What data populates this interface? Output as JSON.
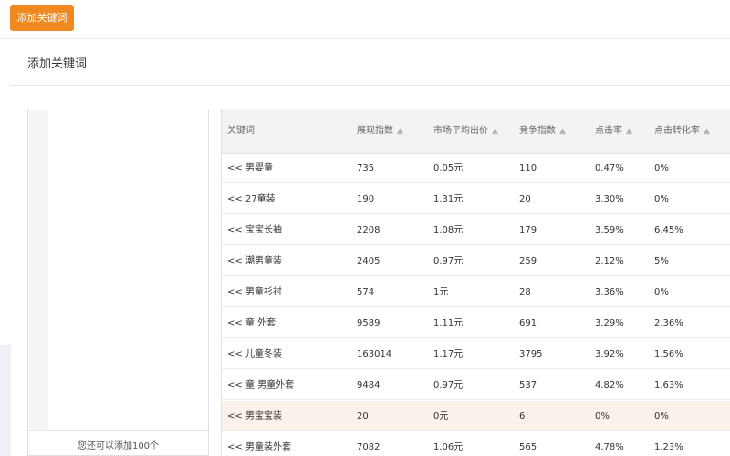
{
  "top_button_label": "添加关键词",
  "panel_title": "添加关键词",
  "left_panel_footer": "您还可以添加100个",
  "table": {
    "headers": [
      "关键词",
      "展现指数",
      "市场平均出价",
      "竞争指数",
      "点击率",
      "点击转化率"
    ],
    "rows": [
      {
        "add": "<<",
        "keyword": "男婴童",
        "impressions": "735",
        "avg_bid": "0.05元",
        "competition": "110",
        "ctr": "0.47%",
        "cvr": "0%"
      },
      {
        "add": "<<",
        "keyword": "27童装",
        "impressions": "190",
        "avg_bid": "1.31元",
        "competition": "20",
        "ctr": "3.30%",
        "cvr": "0%"
      },
      {
        "add": "<<",
        "keyword": "宝宝长袖",
        "impressions": "2208",
        "avg_bid": "1.08元",
        "competition": "179",
        "ctr": "3.59%",
        "cvr": "6.45%"
      },
      {
        "add": "<<",
        "keyword": "潮男童装",
        "impressions": "2405",
        "avg_bid": "0.97元",
        "competition": "259",
        "ctr": "2.12%",
        "cvr": "5%"
      },
      {
        "add": "<<",
        "keyword": "男童衫衬",
        "impressions": "574",
        "avg_bid": "1元",
        "competition": "28",
        "ctr": "3.36%",
        "cvr": "0%"
      },
      {
        "add": "<<",
        "keyword": "童 外套",
        "impressions": "9589",
        "avg_bid": "1.11元",
        "competition": "691",
        "ctr": "3.29%",
        "cvr": "2.36%"
      },
      {
        "add": "<<",
        "keyword": "儿童冬装",
        "impressions": "163014",
        "avg_bid": "1.17元",
        "competition": "3795",
        "ctr": "3.92%",
        "cvr": "1.56%"
      },
      {
        "add": "<<",
        "keyword": "童 男童外套",
        "impressions": "9484",
        "avg_bid": "0.97元",
        "competition": "537",
        "ctr": "4.82%",
        "cvr": "1.63%"
      },
      {
        "add": "<<",
        "keyword": "男宝宝装",
        "impressions": "20",
        "avg_bid": "0元",
        "competition": "6",
        "ctr": "0%",
        "cvr": "0%"
      },
      {
        "add": "<<",
        "keyword": "男童装外套",
        "impressions": "7082",
        "avg_bid": "1.06元",
        "competition": "565",
        "ctr": "4.78%",
        "cvr": "1.23%"
      }
    ]
  },
  "colors": {
    "accent": "#f0891f",
    "header_bg": "#f3f3f3",
    "highlight_row": "#f9f1ea"
  }
}
